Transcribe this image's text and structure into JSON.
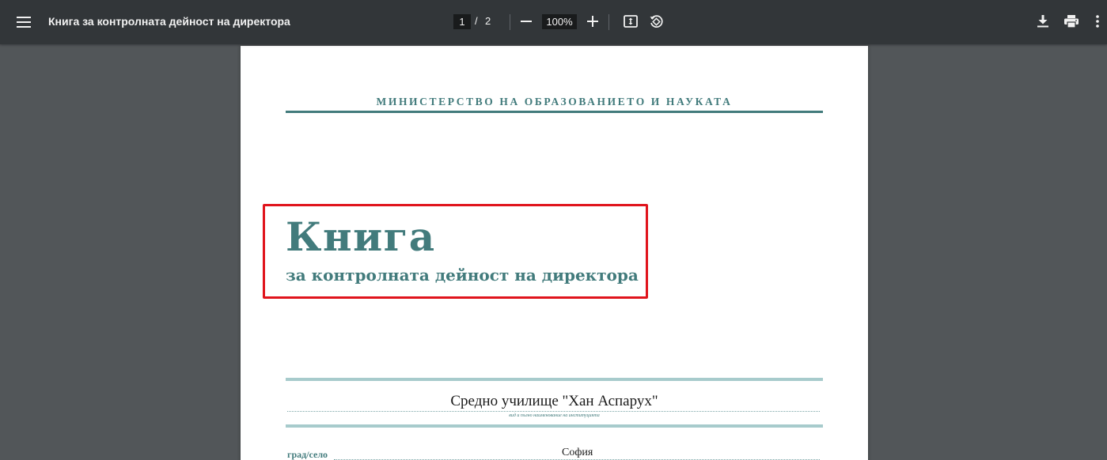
{
  "toolbar": {
    "title": "Книга за контролната дейност на директора",
    "page_current": "1",
    "page_separator": "/",
    "page_total": "2",
    "zoom": "100%",
    "icons": {
      "menu": "menu-icon",
      "zoom_out": "minus-icon",
      "zoom_in": "plus-icon",
      "fit": "fit-to-page-icon",
      "rotate": "rotate-icon",
      "download": "download-icon",
      "print": "print-icon",
      "more": "more-vertical-icon"
    }
  },
  "document": {
    "ministry": "МИНИСТЕРСТВО НА ОБРАЗОВАНИЕТО И НАУКАТА",
    "title": "Книга",
    "subtitle": "за контролната дейност на директора",
    "school_name": "Средно училище \"Хан Аспарух\"",
    "school_caption": "вид и пълно наименование на институцията",
    "city_label": "град/село",
    "city_value": "София"
  },
  "colors": {
    "toolbar_bg": "#323639",
    "viewer_bg": "#525659",
    "accent": "#427b7c",
    "accent_light": "#a7cbcc",
    "highlight": "#e0141c"
  }
}
